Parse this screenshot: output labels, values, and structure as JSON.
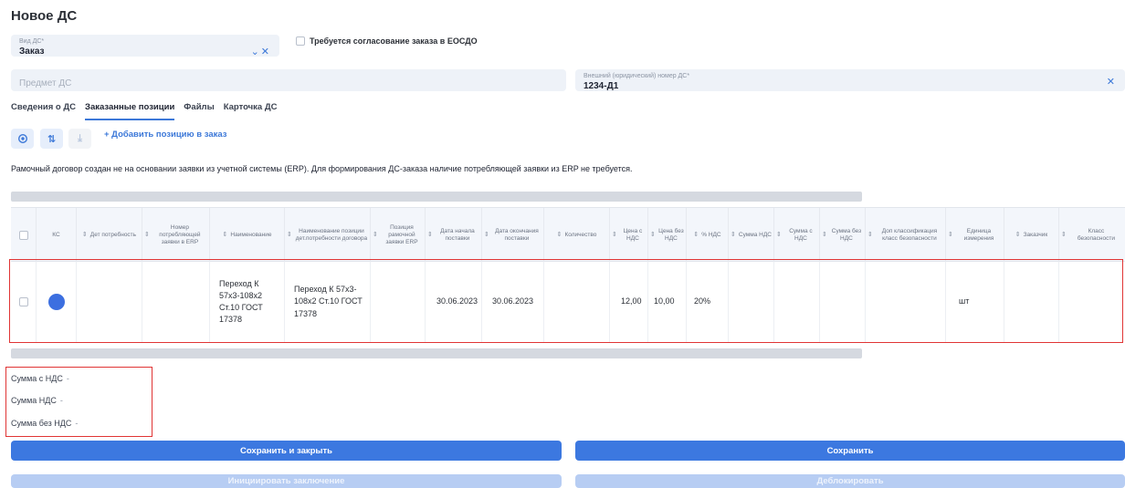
{
  "page": {
    "title": "Новое ДС"
  },
  "form": {
    "ds_type": {
      "label": "Вид ДС*",
      "value": "Заказ"
    },
    "approval_checkbox": {
      "label": "Требуется согласование заказа в ЕОСДО",
      "checked": false
    },
    "subject": {
      "placeholder": "Предмет ДС"
    },
    "external_number": {
      "label": "Внешний (юридический) номер ДС*",
      "value": "1234-Д1"
    }
  },
  "tabs": [
    {
      "label": "Сведения о ДС",
      "active": false
    },
    {
      "label": "Заказанные позиции",
      "active": true
    },
    {
      "label": "Файлы",
      "active": false
    },
    {
      "label": "Карточка ДС",
      "active": false
    }
  ],
  "toolbar": {
    "view_icon": "eye-icon",
    "sort_icon": "sort-arrows-icon",
    "download_icon": "download-icon",
    "add_label": "+ Добавить позицию в заказ"
  },
  "notice": "Рамочный договор создан не на основании заявки из учетной системы (ERP). Для формирования ДС-заказа наличие потребляющей заявки из ERP не требуется.",
  "table": {
    "columns": [
      {
        "key": "select",
        "label": "",
        "sortable": false
      },
      {
        "key": "ks",
        "label": "КС",
        "sortable": false
      },
      {
        "key": "det_need",
        "label": "Дет потребность",
        "sortable": true
      },
      {
        "key": "erp_number",
        "label": "Номер потребляющей заявки в ERP",
        "sortable": true
      },
      {
        "key": "name",
        "label": "Наименование",
        "sortable": true
      },
      {
        "key": "pos_name",
        "label": "Наименование позиции дет.потребности договора",
        "sortable": true
      },
      {
        "key": "frame_pos",
        "label": "Позиция рамочной заявки ERP",
        "sortable": true
      },
      {
        "key": "start_date",
        "label": "Дата начала поставки",
        "sortable": true
      },
      {
        "key": "end_date",
        "label": "Дата окончания поставки",
        "sortable": true
      },
      {
        "key": "qty",
        "label": "Количество",
        "sortable": true
      },
      {
        "key": "price_vat",
        "label": "Цена с НДС",
        "sortable": true
      },
      {
        "key": "price_novat",
        "label": "Цена без НДС",
        "sortable": true
      },
      {
        "key": "vat_pct",
        "label": "% НДС",
        "sortable": true
      },
      {
        "key": "sum_vat",
        "label": "Сумма НДС",
        "sortable": true
      },
      {
        "key": "sum_with_vat",
        "label": "Сумма с НДС",
        "sortable": true
      },
      {
        "key": "sum_novat",
        "label": "Сумма без НДС",
        "sortable": true
      },
      {
        "key": "safety_class_extra",
        "label": "Доп классификация класс безопасности",
        "sortable": true
      },
      {
        "key": "unit",
        "label": "Единица измерения",
        "sortable": true
      },
      {
        "key": "customer",
        "label": "Заказчик",
        "sortable": true
      },
      {
        "key": "safety_class",
        "label": "Класс безопасности",
        "sortable": true
      }
    ],
    "rows": [
      {
        "ks_status_color": "#3c6fe0",
        "name": "Переход К 57х3-108х2 Ст.10 ГОСТ 17378",
        "pos_name": "Переход К 57х3-108х2 Ст.10 ГОСТ 17378",
        "start_date": "30.06.2023",
        "end_date": "30.06.2023",
        "price_vat": "12,00",
        "price_novat": "10,00",
        "vat_pct": "20%",
        "unit": "шт"
      }
    ]
  },
  "totals": [
    {
      "label": "Сумма с НДС",
      "value": "-"
    },
    {
      "label": "Сумма НДС",
      "value": "-"
    },
    {
      "label": "Сумма без НДС",
      "value": "-"
    }
  ],
  "buttons": {
    "save_close": "Сохранить и закрыть",
    "save": "Сохранить",
    "initiate": "Инициировать заключение",
    "unblock": "Деблокировать"
  },
  "colors": {
    "accent": "#3c78e0",
    "highlight": "#e03434",
    "status_dot": "#3c6fe0"
  }
}
